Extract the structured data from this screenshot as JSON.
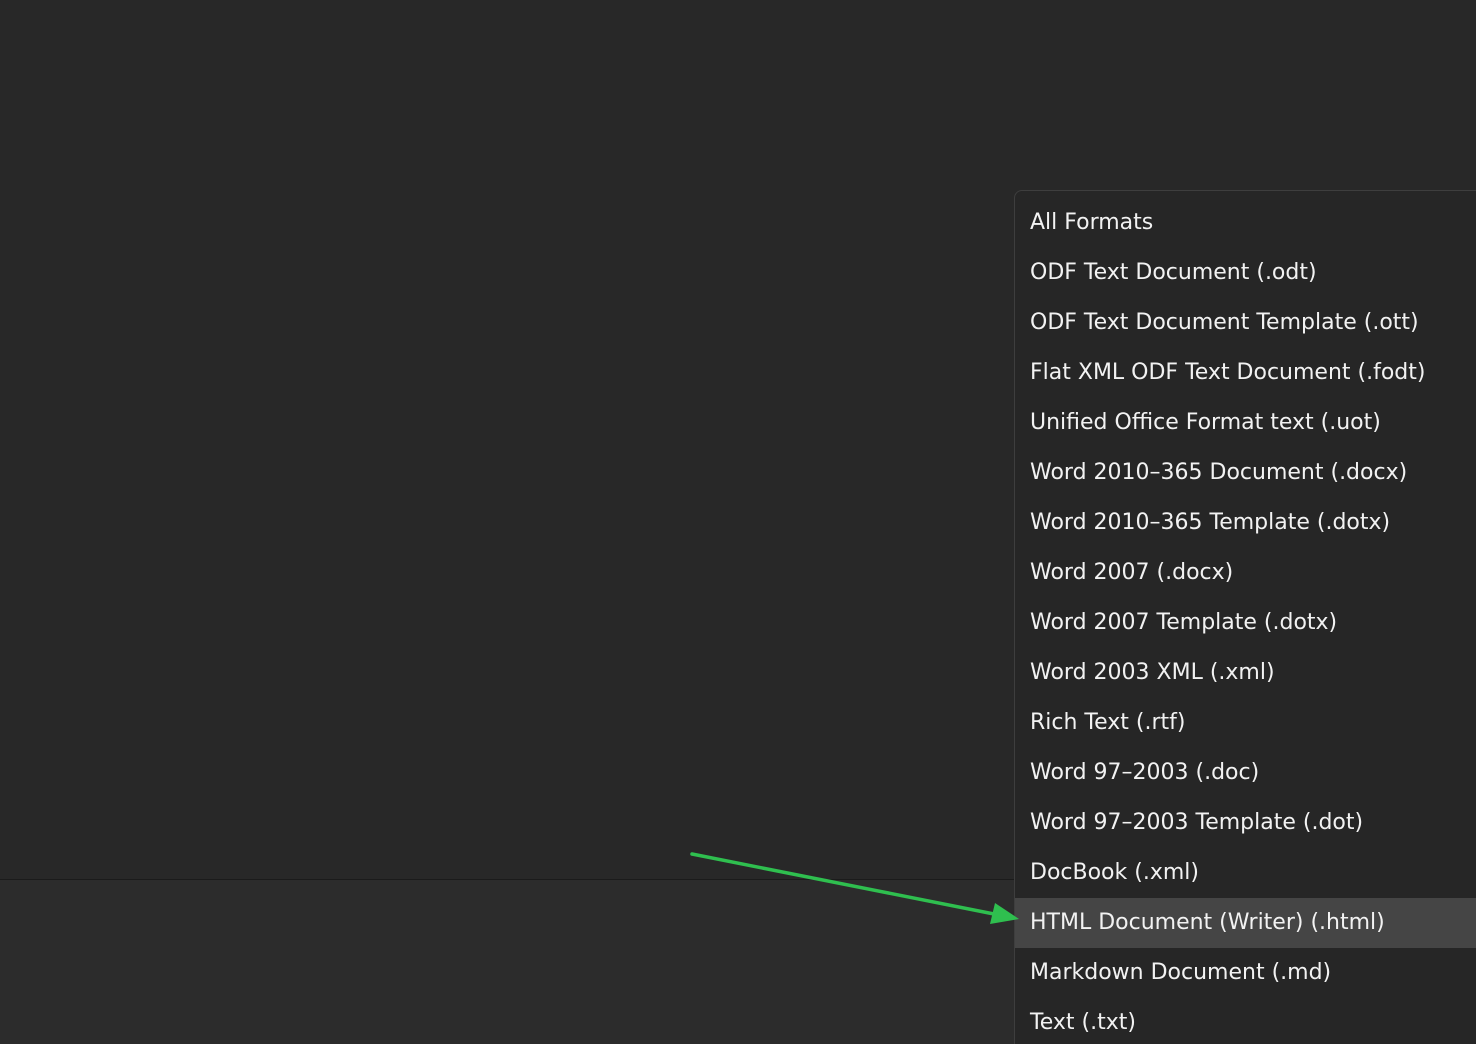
{
  "format_menu": {
    "options": [
      {
        "label": "All Formats"
      },
      {
        "label": "ODF Text Document (.odt)"
      },
      {
        "label": "ODF Text Document Template (.ott)"
      },
      {
        "label": "Flat XML ODF Text Document (.fodt)"
      },
      {
        "label": "Unified Office Format text (.uot)"
      },
      {
        "label": "Word 2010–365 Document (.docx)"
      },
      {
        "label": "Word 2010–365 Template (.dotx)"
      },
      {
        "label": "Word 2007 (.docx)"
      },
      {
        "label": "Word 2007 Template (.dotx)"
      },
      {
        "label": "Word 2003 XML (.xml)"
      },
      {
        "label": "Rich Text (.rtf)"
      },
      {
        "label": "Word 97–2003 (.doc)"
      },
      {
        "label": "Word 97–2003 Template (.dot)"
      },
      {
        "label": "DocBook (.xml)"
      },
      {
        "label": "HTML Document (Writer) (.html)"
      },
      {
        "label": "Markdown Document (.md)"
      },
      {
        "label": "Text (.txt)"
      }
    ],
    "selected_index": 14
  },
  "annotation": {
    "arrow_color": "#2fbf4f",
    "arrow_icon": "annotation-arrow-icon"
  },
  "colors": {
    "background": "#282828",
    "menu_background": "#262626",
    "highlight": "#454545",
    "text": "#f2f2f2"
  }
}
